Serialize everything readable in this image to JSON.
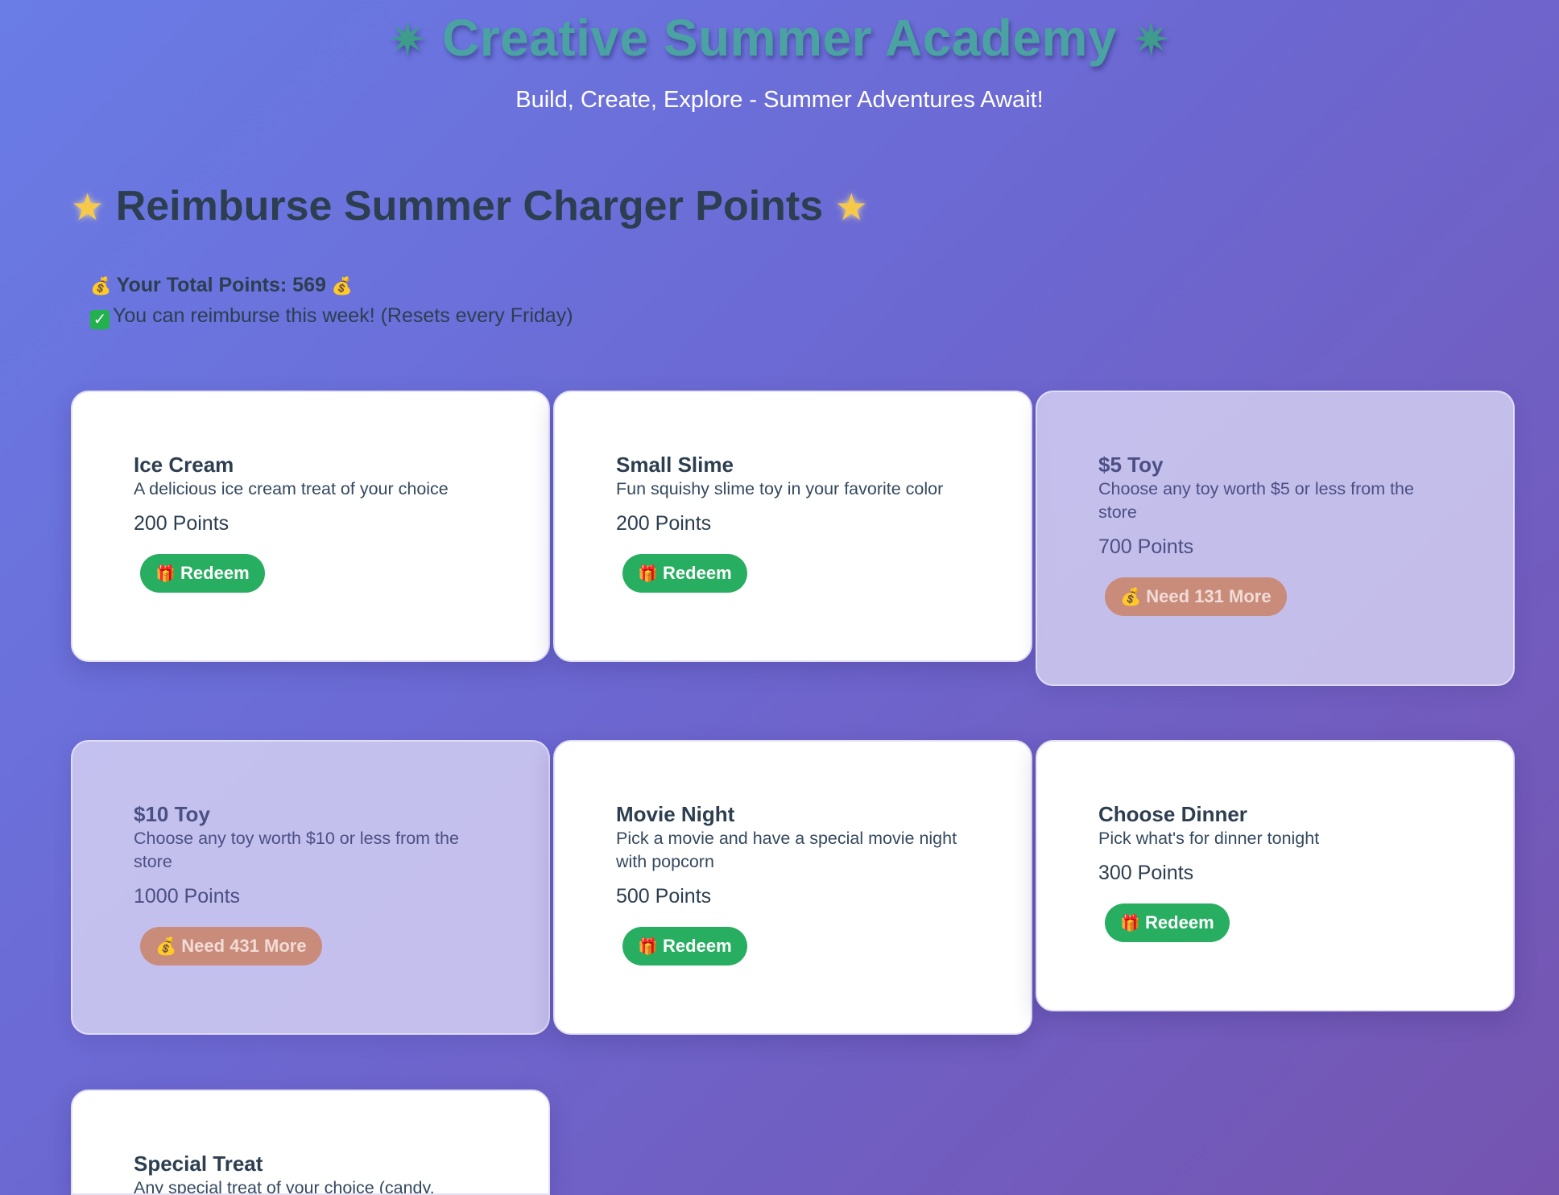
{
  "header": {
    "title": "Creative Summer Academy",
    "title_icon": "sparkle-star-icon",
    "subtitle": "Build, Create, Explore - Summer Adventures Await!"
  },
  "section": {
    "title": "Reimburse Summer Charger Points",
    "title_icon": "glowing-star-icon"
  },
  "points": {
    "total_label": "Your Total Points: 569",
    "total": 569,
    "status_text": "You can reimburse this week! (Resets every Friday)"
  },
  "rewards": [
    {
      "name": "Ice Cream",
      "desc": "A delicious ice cream treat of your choice",
      "cost": "200 Points",
      "button": "Redeem",
      "state": "available"
    },
    {
      "name": "Small Slime",
      "desc": "Fun squishy slime toy in your favorite color",
      "cost": "200 Points",
      "button": "Redeem",
      "state": "available"
    },
    {
      "name": "$5 Toy",
      "desc": "Choose any toy worth $5 or less from the store",
      "cost": "700 Points",
      "button": "Need 131 More",
      "state": "locked"
    },
    {
      "name": "$10 Toy",
      "desc": "Choose any toy worth $10 or less from the store",
      "cost": "1000 Points",
      "button": "Need 431 More",
      "state": "locked"
    },
    {
      "name": "Movie Night",
      "desc": "Pick a movie and have a special movie night with popcorn",
      "cost": "500 Points",
      "button": "Redeem",
      "state": "available"
    },
    {
      "name": "Choose Dinner",
      "desc": "Pick what's for dinner tonight",
      "cost": "300 Points",
      "button": "Redeem",
      "state": "available"
    },
    {
      "name": "Special Treat",
      "desc": "Any special treat of your choice (candy,",
      "cost": "",
      "button": "",
      "state": "available"
    }
  ],
  "colors": {
    "title": "#4aa3a2",
    "redeem_button": "#27ae60",
    "need_button": "#c98b7a",
    "locked_card": "#dcd8f5"
  }
}
